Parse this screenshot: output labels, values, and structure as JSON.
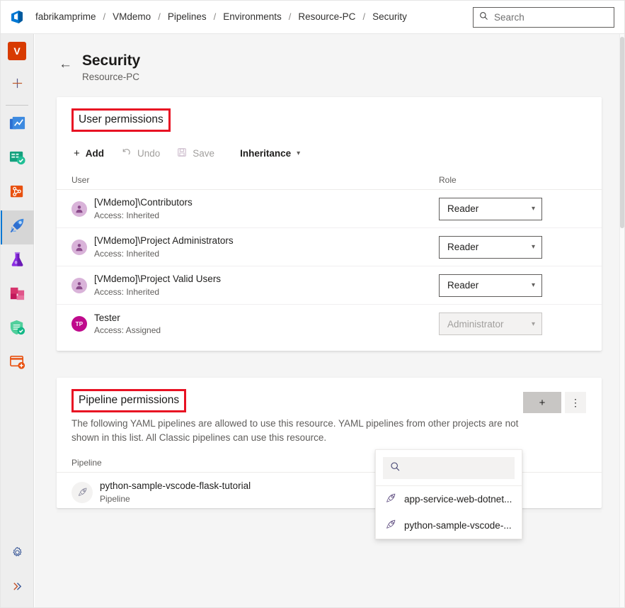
{
  "header": {
    "logo_icon": "azure-devops-logo",
    "breadcrumbs": [
      {
        "label": "fabrikamprime"
      },
      {
        "label": "VMdemo"
      },
      {
        "label": "Pipelines"
      },
      {
        "label": "Environments"
      },
      {
        "label": "Resource-PC"
      },
      {
        "label": "Security"
      }
    ],
    "separator": "/",
    "search": {
      "placeholder": "Search",
      "value": "",
      "icon": "search-icon"
    }
  },
  "sidebar": {
    "profile_initial": "V",
    "items": [
      {
        "name": "new-item",
        "icon": "plus-icon"
      },
      {
        "name": "overview",
        "icon": "overview-boards-icon"
      },
      {
        "name": "boards",
        "icon": "boards-icon"
      },
      {
        "name": "repos",
        "icon": "repos-icon"
      },
      {
        "name": "pipelines",
        "icon": "pipelines-rocket-icon",
        "selected": true
      },
      {
        "name": "test-plans",
        "icon": "test-plans-flask-icon"
      },
      {
        "name": "artifacts",
        "icon": "artifacts-boxes-icon"
      },
      {
        "name": "security",
        "icon": "shield-check-icon"
      },
      {
        "name": "billing",
        "icon": "card-plus-icon"
      }
    ],
    "bottom_items": [
      {
        "name": "project-settings",
        "icon": "gear-icon"
      },
      {
        "name": "expand-sidebar",
        "icon": "chevron-double-right-icon"
      }
    ]
  },
  "page": {
    "back_icon": "back-arrow-icon",
    "title": "Security",
    "subtitle": "Resource-PC"
  },
  "user_permissions": {
    "title": "User permissions",
    "highlighted": true,
    "toolbar": {
      "add_label": "Add",
      "add_icon": "plus-icon",
      "undo_label": "Undo",
      "undo_icon": "undo-icon",
      "save_label": "Save",
      "save_icon": "save-disk-icon",
      "inheritance_label": "Inheritance",
      "inheritance_icon": "chevron-down-icon"
    },
    "columns": {
      "user": "User",
      "role": "Role"
    },
    "rows": [
      {
        "name": "[VMdemo]\\Contributors",
        "access": "Access: Inherited",
        "avatar_type": "group",
        "role": "Reader",
        "role_disabled": false
      },
      {
        "name": "[VMdemo]\\Project Administrators",
        "access": "Access: Inherited",
        "avatar_type": "group",
        "role": "Reader",
        "role_disabled": false
      },
      {
        "name": "[VMdemo]\\Project Valid Users",
        "access": "Access: Inherited",
        "avatar_type": "group",
        "role": "Reader",
        "role_disabled": false
      },
      {
        "name": "Tester",
        "access": "Access: Assigned",
        "avatar_type": "initials",
        "initials": "TP",
        "role": "Administrator",
        "role_disabled": true
      }
    ]
  },
  "pipeline_permissions": {
    "title": "Pipeline permissions",
    "highlighted": true,
    "description": "The following YAML pipelines are allowed to use this resource. YAML pipelines from other projects are not shown in this list. All Classic pipelines can use this resource.",
    "add_button_icon": "plus-icon",
    "more_button_icon": "more-vertical-icon",
    "column_pipeline": "Pipeline",
    "rows": [
      {
        "name": "python-sample-vscode-flask-tutorial",
        "type": "Pipeline",
        "icon": "rocket-icon"
      }
    ],
    "dropdown": {
      "open": true,
      "search": {
        "placeholder": "",
        "value": "",
        "icon": "search-icon"
      },
      "options": [
        {
          "label": "app-service-web-dotnet...",
          "icon": "rocket-icon"
        },
        {
          "label": "python-sample-vscode-...",
          "icon": "rocket-icon"
        }
      ]
    }
  },
  "colors": {
    "accent": "#0078d4",
    "highlight_red": "#e81123",
    "group_avatar": "#d9b3d9",
    "user_avatar": "#bf0a8c",
    "rail_bg": "#eeeeee",
    "content_bg": "#f5f5f5"
  }
}
